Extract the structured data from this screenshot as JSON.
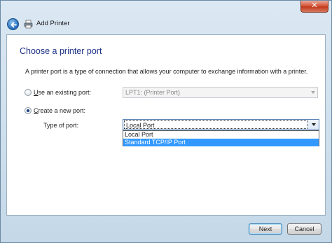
{
  "window": {
    "title": "Add Printer",
    "close_glyph": "✕"
  },
  "page": {
    "heading": "Choose a printer port",
    "description": "A printer port is a type of connection that allows your computer to exchange information with a printer."
  },
  "options": {
    "existing": {
      "prefix": "",
      "accel": "U",
      "rest": "se an existing port:",
      "value": "LPT1: (Printer Port)",
      "checked": false
    },
    "new": {
      "prefix": "",
      "accel": "C",
      "rest": "reate a new port:",
      "checked": true
    }
  },
  "type_of_port": {
    "label": "Type of port:",
    "selected": "Local Port",
    "options": [
      "Local Port",
      "Standard TCP/IP Port"
    ],
    "highlighted_index": 1
  },
  "buttons": {
    "next": "Next",
    "cancel": "Cancel"
  },
  "colors": {
    "heading": "#1e3287",
    "highlight": "#3399ff",
    "close": "#c23b1d"
  },
  "icons": [
    "close-icon",
    "back-arrow-icon",
    "printer-icon",
    "radio-button",
    "dropdown-arrow-icon"
  ]
}
